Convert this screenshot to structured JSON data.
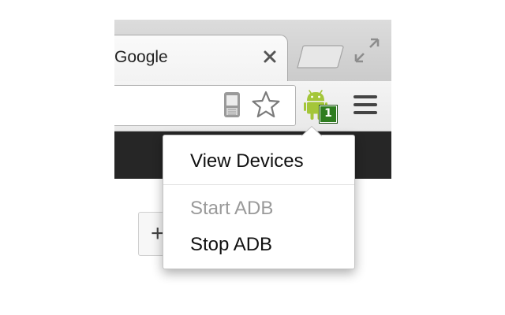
{
  "tab": {
    "title": "Google"
  },
  "extension": {
    "device_count": "1",
    "accent_color": "#a4c639",
    "badge_color": "#2e7d1f"
  },
  "toolbar": {
    "icons": [
      "send-to-device-icon",
      "star-icon",
      "android-icon",
      "menu-icon"
    ]
  },
  "page": {
    "add_button_label": "+"
  },
  "popup": {
    "items": [
      {
        "label": "View Devices",
        "enabled": true
      },
      {
        "label": "Start ADB",
        "enabled": false
      },
      {
        "label": "Stop ADB",
        "enabled": true
      }
    ]
  }
}
